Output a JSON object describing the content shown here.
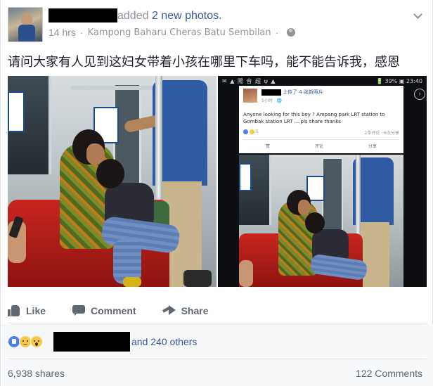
{
  "post": {
    "action_text": "added",
    "photos_link": "2 new photos.",
    "time": "14 hrs",
    "location": "Kampong Baharu Cheras Batu Sembilan",
    "separator": "·",
    "text": "请问大家有人见到这妇女带着小孩在哪里下车吗，能不能告诉我，感恩"
  },
  "embedded_screenshot": {
    "status_left": "✉ ▲ 陽 音 超 ψ ▲",
    "status_right": "🔋 39% ▣ 23:40",
    "action": "上传了 4 张新照片",
    "time": "5小时 · 🌐",
    "text": "Anyone looking for this boy ? Ampang park LRT station to Gombak station LRT ....pls share thanks",
    "reaction_count": "5",
    "stats": "2条评论 · 6次分享",
    "buttons": [
      "赞",
      "评论",
      "分享"
    ]
  },
  "actions": {
    "like": "Like",
    "comment": "Comment",
    "share": "Share"
  },
  "reactions": {
    "types": [
      "like-icon",
      "sad-icon",
      "wow-icon"
    ],
    "others_text": "and 240 others"
  },
  "stats": {
    "shares": "6,938 shares",
    "comments": "122 Comments"
  },
  "colors": {
    "link": "#365899",
    "muted": "#90949c",
    "action": "#606770",
    "like_blue": "#4a80e8",
    "reaction_yellow": "#f7c94a"
  }
}
